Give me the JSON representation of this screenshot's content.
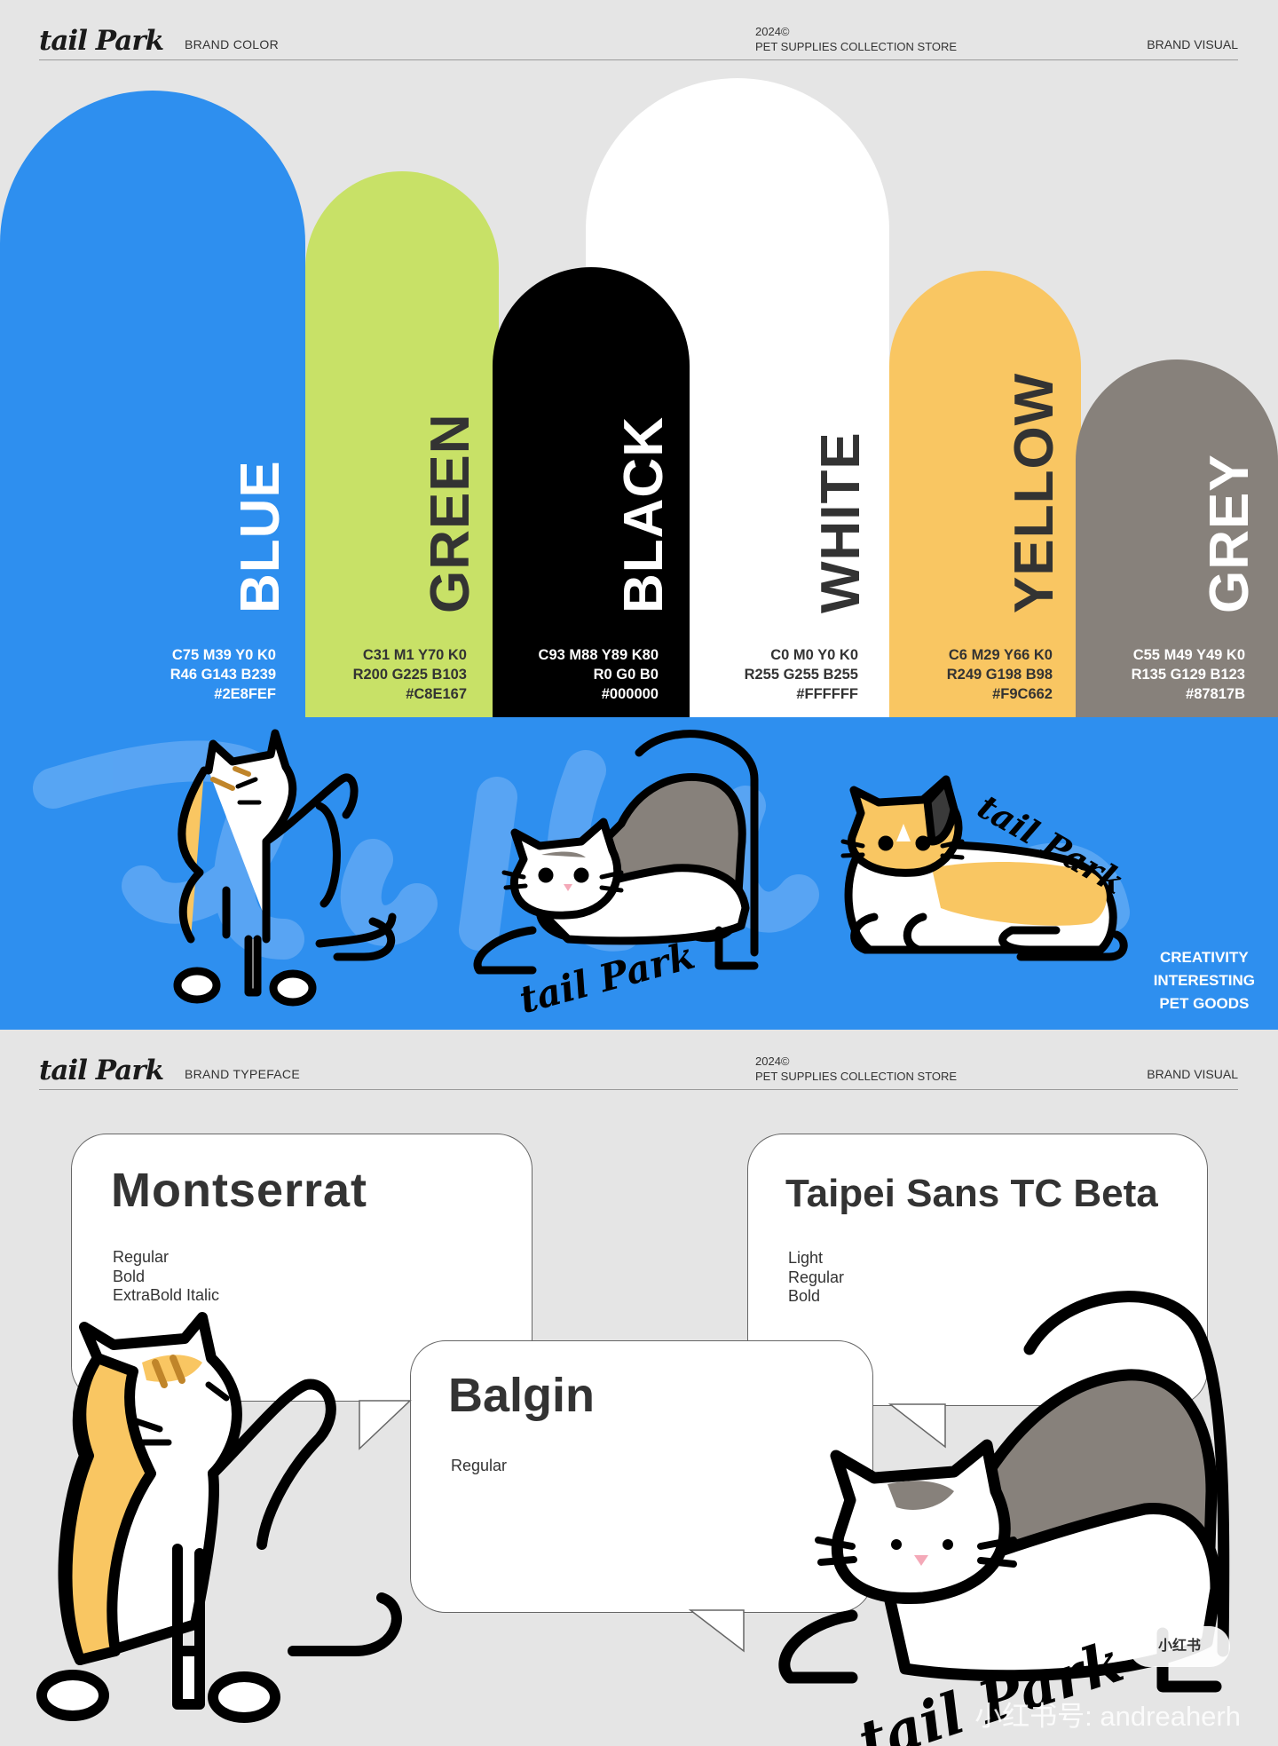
{
  "brand": {
    "logo_text": "tail Park"
  },
  "header_top": {
    "section_label": "BRAND COLOR",
    "year": "2024©",
    "store": "PET SUPPLIES COLLECTION STORE",
    "right_label": "BRAND VISUAL"
  },
  "colors": [
    {
      "name": "BLUE",
      "cmyk": "C75 M39 Y0 K0",
      "rgb": "R46 G143 B239",
      "hex": "#2E8FEF",
      "fill": "#2e8fef",
      "text_color": "#ffffff"
    },
    {
      "name": "GREEN",
      "cmyk": "C31 M1 Y70 K0",
      "rgb": "R200 G225 B103",
      "hex": "#C8E167",
      "fill": "#c8e167",
      "text_color": "#333333"
    },
    {
      "name": "BLACK",
      "cmyk": "C93 M88 Y89 K80",
      "rgb": "R0 G0 B0",
      "hex": "#000000",
      "fill": "#000000",
      "text_color": "#ffffff"
    },
    {
      "name": "WHITE",
      "cmyk": "C0 M0 Y0 K0",
      "rgb": "R255 G255 B255",
      "hex": "#FFFFFF",
      "fill": "#ffffff",
      "text_color": "#333333"
    },
    {
      "name": "YELLOW",
      "cmyk": "C6 M29 Y66 K0",
      "rgb": "R249 G198 B98",
      "hex": "#F9C662",
      "fill": "#f9c662",
      "text_color": "#333333"
    },
    {
      "name": "GREY",
      "cmyk": "C55 M49 Y49 K0",
      "rgb": "R135 G129 B123",
      "hex": "#87817B",
      "fill": "#87817b",
      "text_color": "#ffffff"
    }
  ],
  "banner": {
    "slogan": [
      "CREATIVITY",
      "INTERESTING",
      "PET GOODS"
    ],
    "signature": "tail Park"
  },
  "header_bottom": {
    "section_label": "BRAND TYPEFACE",
    "year": "2024©",
    "store": "PET SUPPLIES COLLECTION STORE",
    "right_label": "BRAND VISUAL"
  },
  "typefaces": [
    {
      "name": "Montserrat",
      "styles": [
        "Regular",
        "Bold",
        "ExtraBold Italic"
      ]
    },
    {
      "name": "Balgin",
      "styles": [
        "Regular"
      ]
    },
    {
      "name": "Taipei Sans TC Beta",
      "styles": [
        "Light",
        "Regular",
        "Bold"
      ]
    }
  ],
  "watermark": {
    "text": "小红书号: andreaherh",
    "badge": "小红书"
  }
}
